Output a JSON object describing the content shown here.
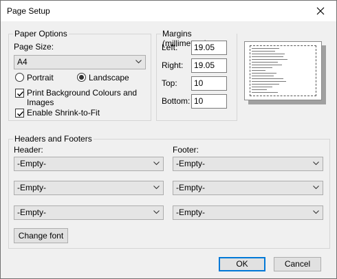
{
  "window": {
    "title": "Page Setup"
  },
  "paper_options": {
    "legend": "Paper Options",
    "page_size_label": "Page Size:",
    "page_size_value": "A4",
    "orientation": {
      "portrait_label": "Portrait",
      "landscape_label": "Landscape",
      "selected": "Landscape"
    },
    "print_background": {
      "label": "Print Background Colours and Images",
      "label_line1": "Print Background Colours and",
      "label_line2": "Images",
      "checked": true
    },
    "shrink_to_fit": {
      "label": "Enable Shrink-to-Fit",
      "checked": true
    }
  },
  "margins": {
    "legend": "Margins (millimetres)",
    "left_label": "Left:",
    "left_value": "19.05",
    "right_label": "Right:",
    "right_value": "19.05",
    "top_label": "Top:",
    "top_value": "10",
    "bottom_label": "Bottom:",
    "bottom_value": "10"
  },
  "headers_footers": {
    "legend": "Headers and Footers",
    "header_label": "Header:",
    "footer_label": "Footer:",
    "header_values": [
      "-Empty-",
      "-Empty-",
      "-Empty-"
    ],
    "footer_values": [
      "-Empty-",
      "-Empty-",
      "-Empty-"
    ],
    "change_font_label": "Change font"
  },
  "buttons": {
    "ok": "OK",
    "cancel": "Cancel"
  }
}
